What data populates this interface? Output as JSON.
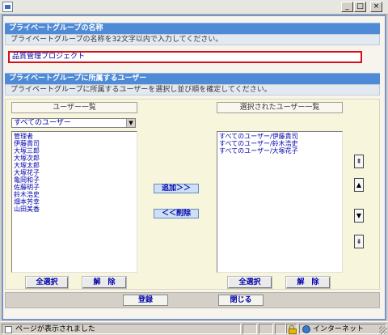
{
  "window": {
    "title": "",
    "minimize_glyph": "_",
    "maximize_glyph": "□",
    "close_glyph": "×"
  },
  "group_name_section": {
    "heading": "プライベートグループの名称",
    "description": "プライベートグループの名称を32文字以内で入力してください。",
    "name_value": "品質管理プロジェクト"
  },
  "member_section": {
    "heading": "プライベートグループに所属するユーザー",
    "description": "プライベートグループに所属するユーザーを選択し並び順を確定してください。"
  },
  "user_list": {
    "title": "ユーザー一覧",
    "filter_selected": "すべてのユーザー",
    "items": [
      "管理者",
      "伊藤貴司",
      "大塚三郎",
      "大塚次郎",
      "大塚太郎",
      "大塚花子",
      "亀岡和子",
      "佐藤明子",
      "鈴木浩史",
      "畑本芳幸",
      "山田美香"
    ],
    "select_all_label": "全選択",
    "clear_label": "解　除"
  },
  "transfer": {
    "add_label": "追加＞＞",
    "remove_label": "＜＜削除"
  },
  "selected_list": {
    "title": "選択されたユーザー一覧",
    "items": [
      "すべてのユーザー/伊藤貴司",
      "すべてのユーザー/鈴木浩史",
      "すべてのユーザー/大塚花子"
    ],
    "select_all_label": "全選択",
    "clear_label": "解　除"
  },
  "order_buttons": {
    "top_glyph": "⇞",
    "up_glyph": "▲",
    "down_glyph": "▼",
    "bottom_glyph": "⇟"
  },
  "footer": {
    "register_label": "登録",
    "close_label": "閉じる"
  },
  "statusbar": {
    "message": "ページが表示されました",
    "zone": "インターネット"
  },
  "colors": {
    "section_header": "#4f8ad6",
    "link_text": "#0000aa",
    "input_border": "#d8101a"
  }
}
